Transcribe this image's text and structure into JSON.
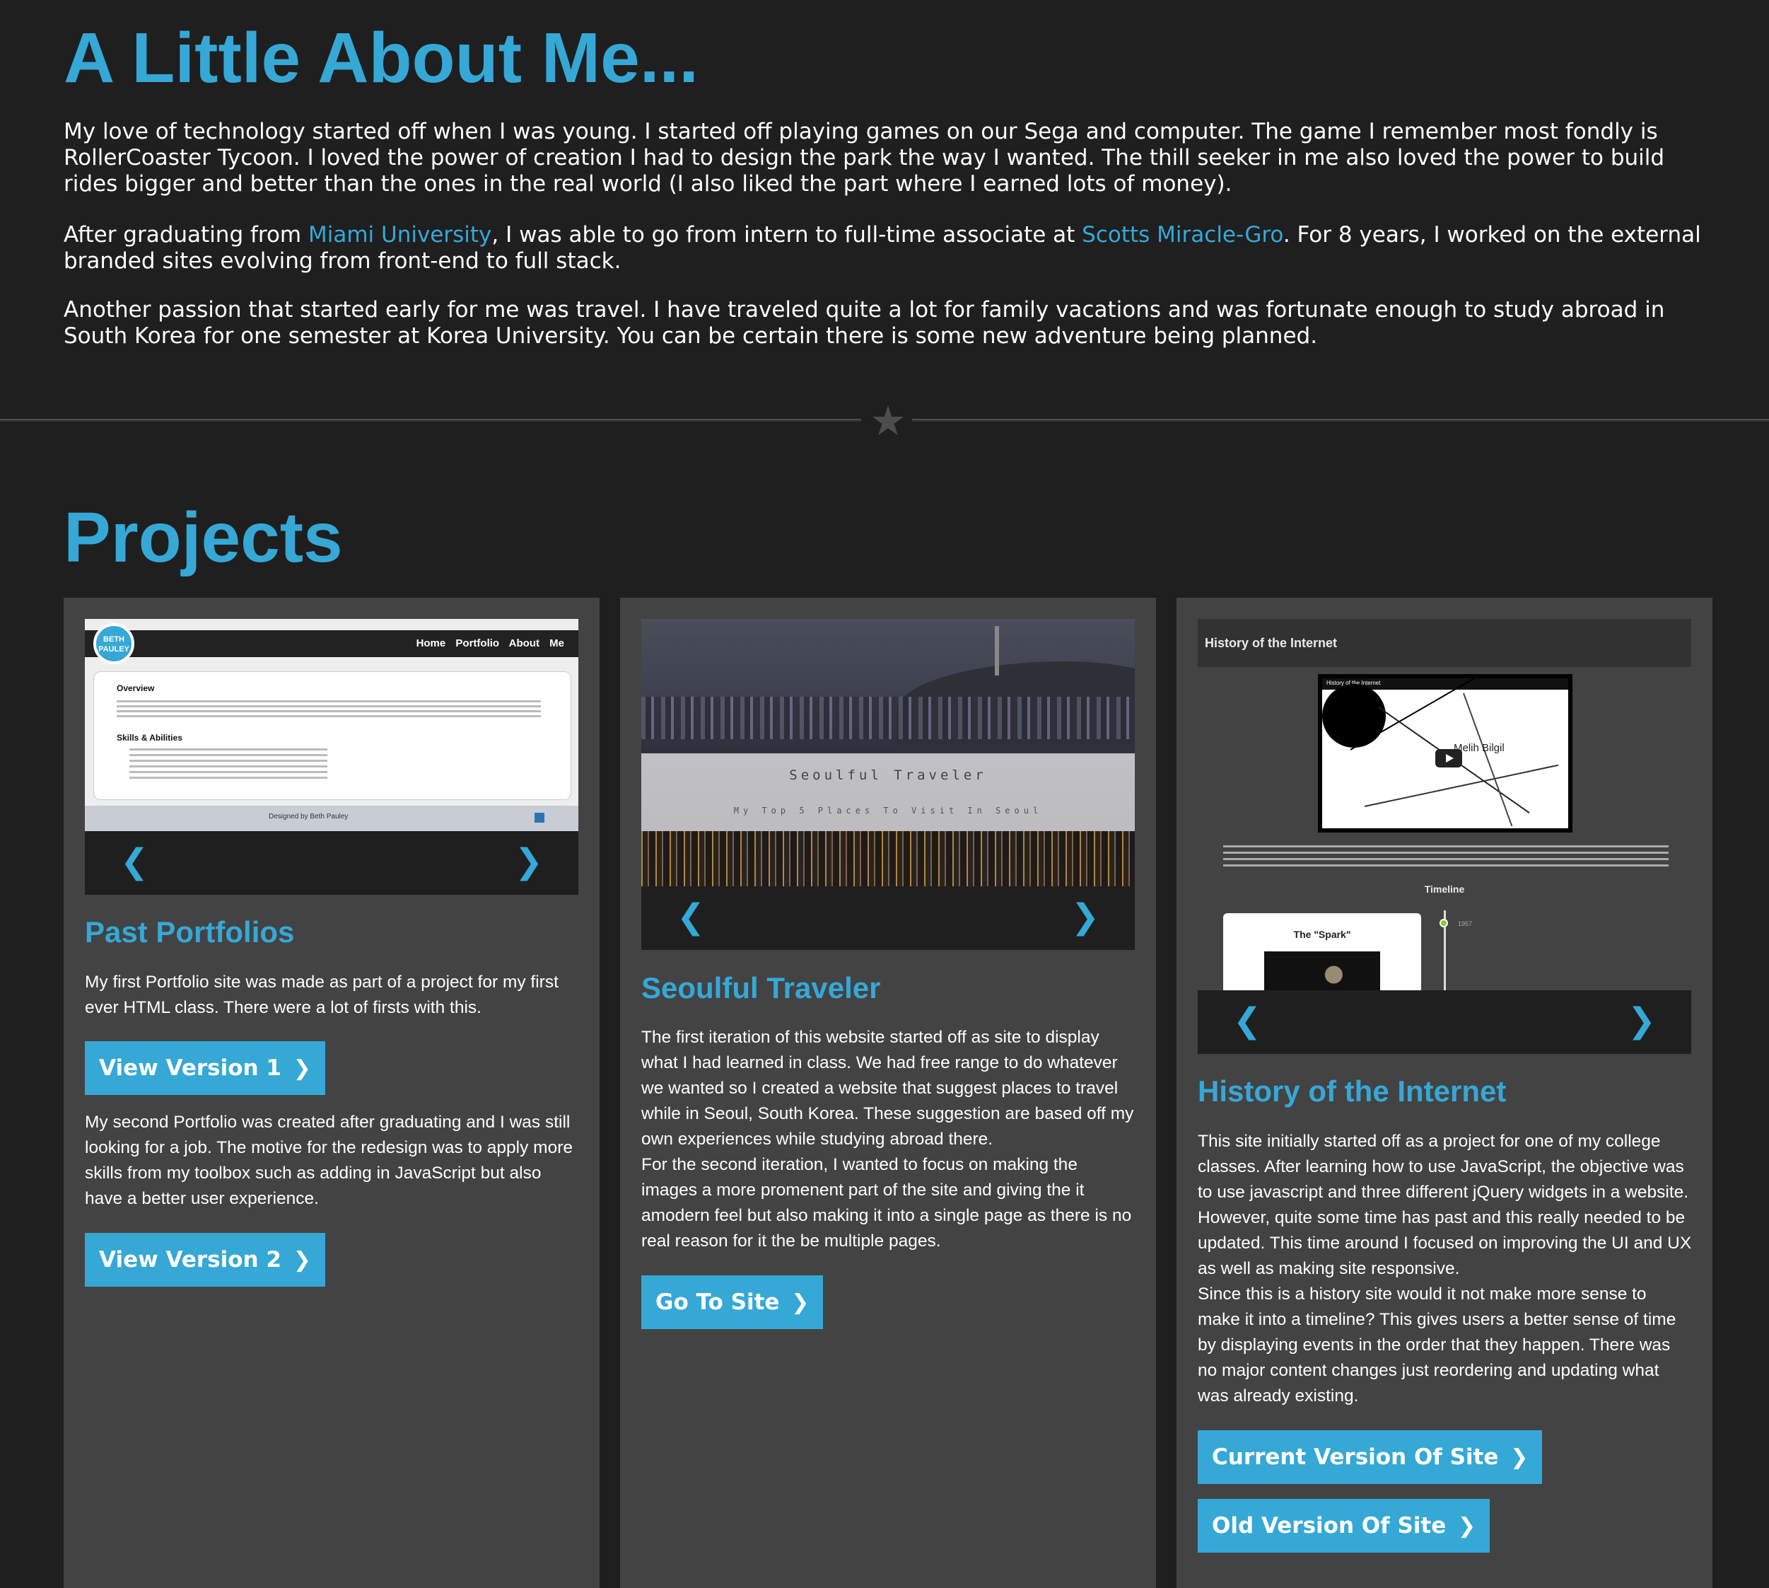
{
  "about": {
    "heading": "A Little About Me...",
    "p1": "My love of technology started off when I was young. I started off playing games on our Sega and computer. The game I remember most fondly is RollerCoaster Tycoon. I loved the power of creation I had to design the park the way I wanted. The thill seeker in me also loved the power to build rides bigger and better than the ones in the real world (I also liked the part where I earned lots of money).",
    "p2_before": "After graduating from ",
    "p2_link1": "Miami University",
    "p2_middle": ", I was able to go from intern to full-time associate at ",
    "p2_link2": "Scotts Miracle-Gro",
    "p2_after": ". For 8 years, I worked on the external branded sites evolving from front-end to full stack.",
    "p3": "Another passion that started early for me was travel. I have traveled quite a lot for family vacations and was fortunate enough to study abroad in South Korea for one semester at Korea University. You can be certain there is some new adventure being planned."
  },
  "divider": {
    "icon": "star-icon",
    "glyph": "★"
  },
  "projects": {
    "heading": "Projects",
    "nav": {
      "prev": "❮",
      "next": "❯"
    },
    "button_chevron": "❯",
    "cards": [
      {
        "title": "Past Portfolios",
        "desc1": "My first Portfolio site was made as part of a project for my first ever HTML class. There were a lot of firsts with this.",
        "button1": "View Version 1",
        "desc2": "My second Portfolio was created after graduating and I was still looking for a job. The motive for the redesign was to apply more skills from my toolbox such as adding in JavaScript but also have a better user experience.",
        "button2": "View Version 2",
        "thumb": {
          "logo": "BETH PAULEY",
          "menu": "Home Portfolio About Me",
          "overview": "Overview",
          "skills": "Skills & Abilities",
          "footer": "Designed by Beth Pauley"
        }
      },
      {
        "title": "Seoulful Traveler",
        "desc1": "The first iteration of this website started off as site to display what I had learned in class. We had free range to do whatever we wanted so I created a website that suggest places to travel while in Seoul, South Korea. These suggestion are based off my own experiences while studying abroad there.",
        "desc2": "For the second iteration, I wanted to focus on making the images a more promenent part of the site and giving the it amodern feel but also making it into a single page as there is no real reason for it the be multiple pages.",
        "button1": "Go To Site",
        "thumb": {
          "title": "Seoulful Traveler",
          "subtitle": "My Top 5 Places To Visit In Seoul"
        }
      },
      {
        "title": "History of the Internet",
        "desc1": "This site initially started off as a project for one of my college classes. After learning how to use JavaScript, the objective was to use javascript and three different jQuery widgets in a website. However, quite some time has past and this really needed to be updated. This time around I focused on improving the UI and UX as well as making site responsive.",
        "desc2": "Since this is a history site would it not make more sense to make it into a timeline? This gives users a better sense of time by displaying events in the order that they happen. There was no major content changes just reordering and updating what was already existing.",
        "button1": "Current Version Of Site",
        "button2": "Old Version Of Site",
        "thumb": {
          "header": "History of the Internet",
          "video_title": "History of the Internet",
          "video_name": "Melih Bilgil",
          "timeline": "Timeline",
          "spark": "The \"Spark\"",
          "year": "1957"
        }
      }
    ]
  },
  "colors": {
    "accent": "#35a8d6",
    "background": "#1f1f20",
    "card": "#434344"
  }
}
